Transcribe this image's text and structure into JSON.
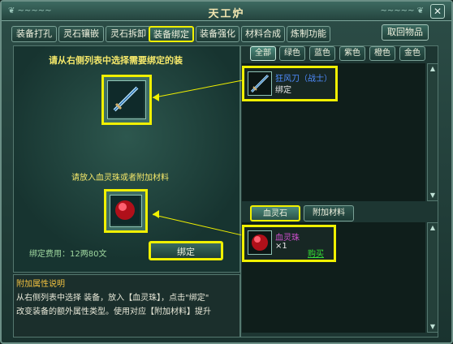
{
  "window": {
    "title": "天工炉",
    "close_glyph": "✕"
  },
  "tabs": [
    {
      "label": "装备打孔"
    },
    {
      "label": "灵石镶嵌"
    },
    {
      "label": "灵石拆卸"
    },
    {
      "label": "装备绑定"
    },
    {
      "label": "装备强化"
    },
    {
      "label": "材料合成"
    },
    {
      "label": "炼制功能"
    }
  ],
  "retrieve_button": "取回物品",
  "left": {
    "instruction": "请从右侧列表中选择需要绑定的装",
    "material_hint": "请放入血灵珠或者附加材料",
    "fee_text": "绑定费用：12两80文",
    "bind_button": "绑定"
  },
  "description": {
    "title": "附加属性说明",
    "lines": [
      "从右侧列表中选择 装备，放入【血灵珠】，点击\"绑定\"",
      "改变装备的额外属性类型。使用对应【附加材料】提升"
    ]
  },
  "filters": [
    {
      "label": "全部"
    },
    {
      "label": "绿色"
    },
    {
      "label": "蓝色"
    },
    {
      "label": "紫色"
    },
    {
      "label": "橙色"
    },
    {
      "label": "金色"
    }
  ],
  "equipment_list": [
    {
      "name": "狂风刀（战士）",
      "status": "绑定",
      "icon": "blade-icon"
    }
  ],
  "material_tabs": [
    {
      "label": "血灵石"
    },
    {
      "label": "附加材料"
    }
  ],
  "material_list": [
    {
      "name": "血灵珠",
      "count": "×1",
      "buy_label": "购买",
      "icon": "red-orb-icon"
    }
  ],
  "colors": {
    "highlight": "#f0f000",
    "item_name_blue": "#4f8cff",
    "material_name_purple": "#d050d0",
    "buy_green": "#36e036"
  }
}
